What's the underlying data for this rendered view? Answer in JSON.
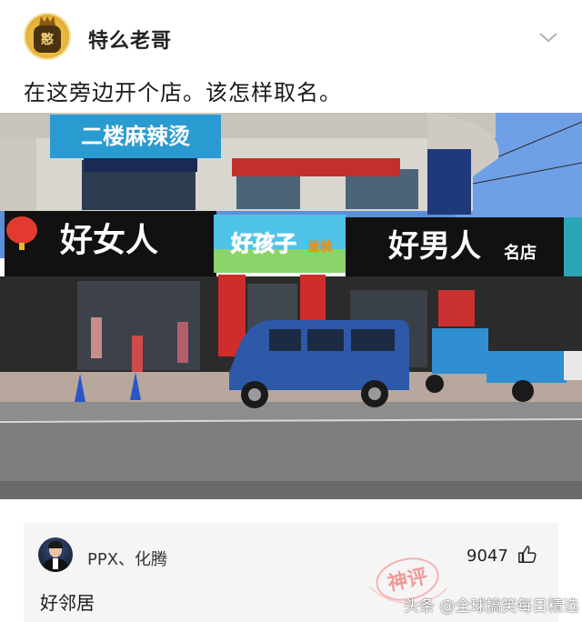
{
  "post": {
    "author": "特么老哥",
    "avatar_badge": "憨",
    "text": "在这旁边开个店。该怎样取名。",
    "menu_icon": "chevron-down-icon"
  },
  "photo": {
    "signs": {
      "spicy_hotpot": "二楼麻辣烫",
      "good_woman": "好女人",
      "good_kid": "好孩子",
      "good_kid_sub": "童装",
      "good_man": "好男人",
      "good_man_suffix": "名店"
    }
  },
  "comment": {
    "user": "PPX、化腾",
    "likes": "9047",
    "text": "好邻居",
    "stamp_text": "神评",
    "watermark": "头条 @全球搞笑每日精选",
    "like_icon": "thumbs-up-icon"
  },
  "colors": {
    "accent_gold": "#e8b43a",
    "comment_bg": "#f5f5f5",
    "stamp_red": "#f08c8c"
  }
}
